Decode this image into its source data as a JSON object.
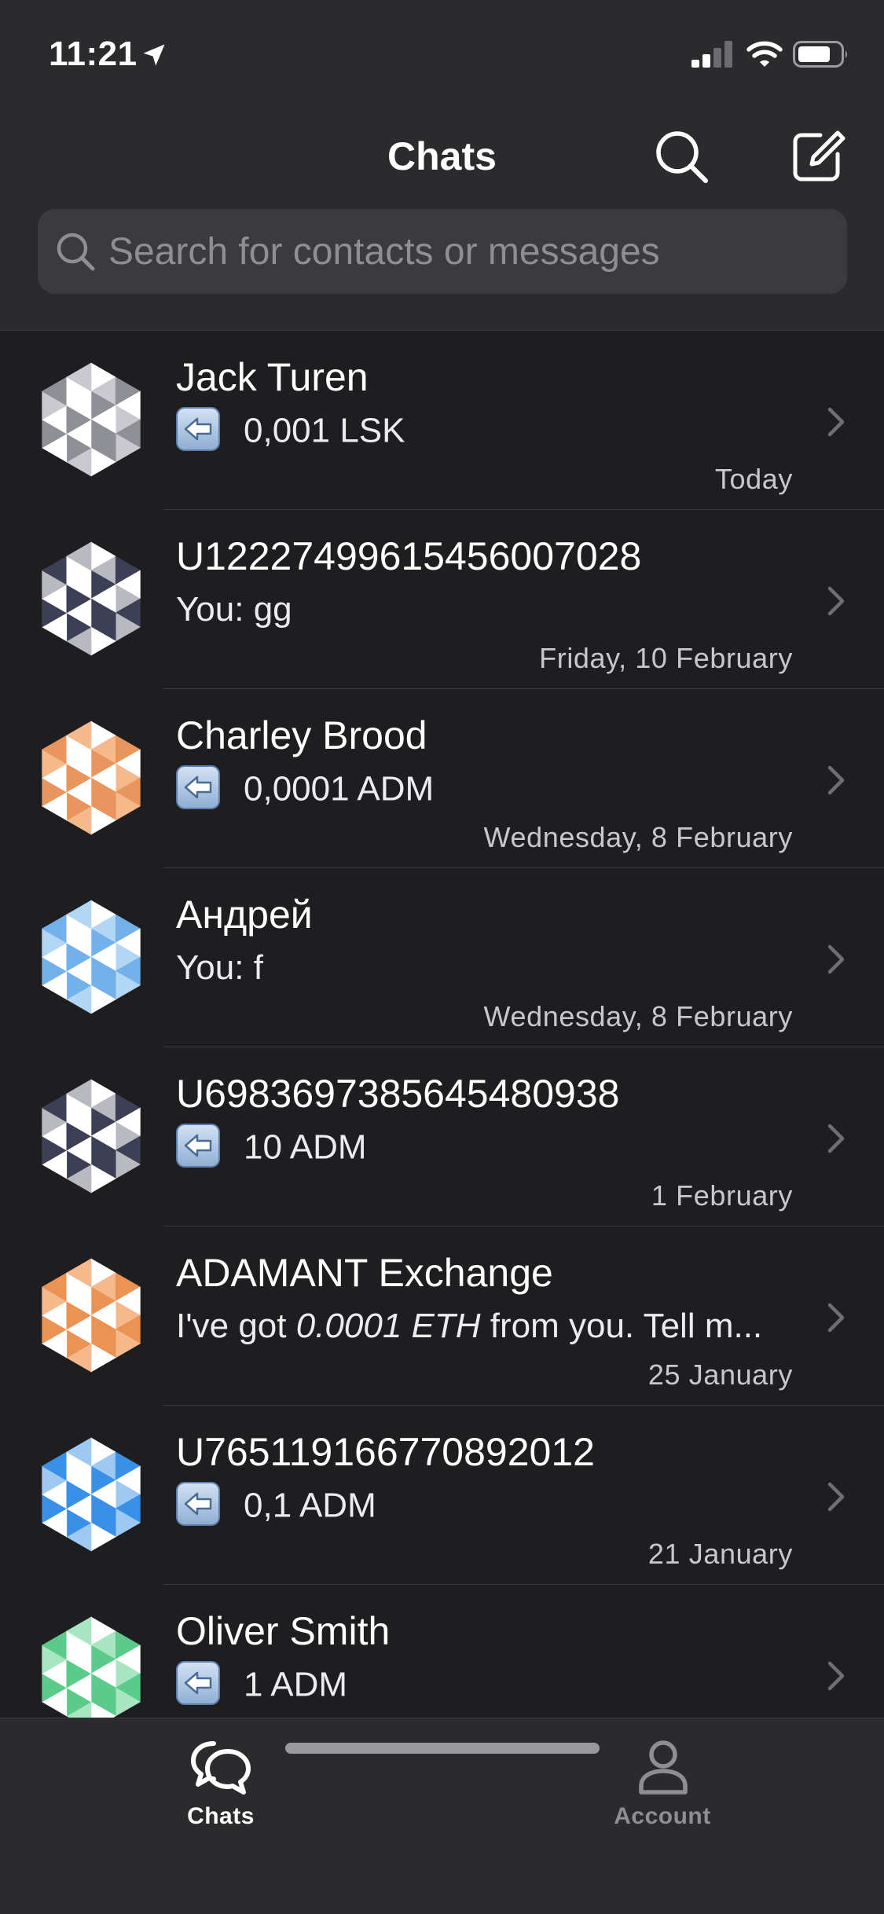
{
  "status_bar": {
    "time": "11:21",
    "location_icon": "location-arrow-icon",
    "signal_icon": "cellular-signal-icon",
    "wifi_icon": "wifi-icon",
    "battery_icon": "battery-icon"
  },
  "header": {
    "title": "Chats",
    "search_icon": "search-icon",
    "compose_icon": "compose-icon"
  },
  "search": {
    "placeholder": "Search for contacts or messages"
  },
  "chats": [
    {
      "name": "Jack Turen",
      "kind": "transfer",
      "preview": "0,001 LSK",
      "date": "Today",
      "avatar_palette": [
        "#ffffff",
        "#c9c9cf",
        "#8f8f96"
      ]
    },
    {
      "name": "U12227499615456007028",
      "kind": "text",
      "preview": "You: gg",
      "date": "Friday, 10 February",
      "avatar_palette": [
        "#ffffff",
        "#b9b9c0",
        "#3c3f55"
      ]
    },
    {
      "name": "Charley Brood",
      "kind": "transfer",
      "preview": "0,0001 ADM",
      "date": "Wednesday, 8 February",
      "avatar_palette": [
        "#ffffff",
        "#f6b98c",
        "#e8955e"
      ]
    },
    {
      "name": "Андрей",
      "kind": "text",
      "preview": "You: f",
      "date": "Wednesday, 8 February",
      "avatar_palette": [
        "#ffffff",
        "#b3d6f5",
        "#74b0ea"
      ]
    },
    {
      "name": "U6983697385645480938",
      "kind": "transfer",
      "preview": "10 ADM",
      "date": "1 February",
      "avatar_palette": [
        "#ffffff",
        "#b9b9c0",
        "#3c3f55"
      ]
    },
    {
      "name": "ADAMANT Exchange",
      "kind": "rich",
      "preview_before": "I've got ",
      "preview_em": "0.0001 ETH",
      "preview_after": " from you. Tell m...",
      "date": "25 January",
      "avatar_palette": [
        "#ffffff",
        "#f6b98c",
        "#ea9354"
      ]
    },
    {
      "name": "U765119166770892012",
      "kind": "transfer",
      "preview": "0,1 ADM",
      "date": "21 January",
      "avatar_palette": [
        "#ffffff",
        "#9ec9f3",
        "#3a8fe6"
      ]
    },
    {
      "name": "Oliver Smith",
      "kind": "transfer",
      "preview": "1 ADM",
      "date": "",
      "avatar_palette": [
        "#ffffff",
        "#a8e6c2",
        "#5ccb8a"
      ]
    }
  ],
  "tabs": [
    {
      "label": "Chats",
      "icon": "chat-bubbles-icon",
      "active": true
    },
    {
      "label": "Account",
      "icon": "person-icon",
      "active": false
    }
  ]
}
